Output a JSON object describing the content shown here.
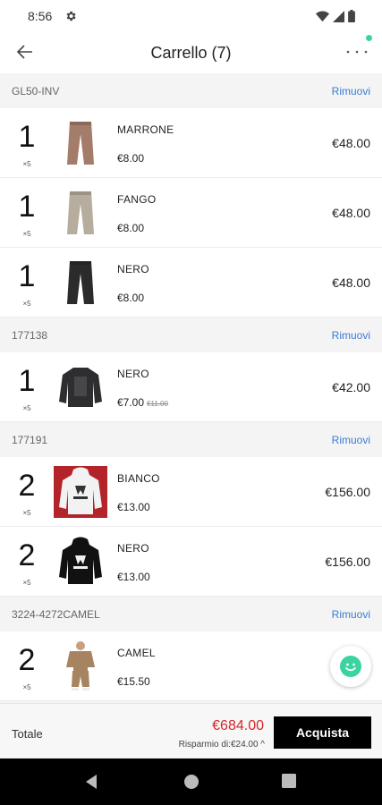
{
  "status_bar": {
    "time": "8:56"
  },
  "header": {
    "title": "Carrello (7)"
  },
  "groups": [
    {
      "code": "GL50-INV",
      "remove_label": "Rimuovi",
      "items": [
        {
          "qty": "1",
          "qty_suffix": "×5",
          "name": "MARRONE",
          "price": "€8.00",
          "total": "€48.00",
          "image": "pants-icon",
          "color": "#a47c6a"
        },
        {
          "qty": "1",
          "qty_suffix": "×5",
          "name": "FANGO",
          "price": "€8.00",
          "total": "€48.00",
          "image": "pants-icon",
          "color": "#b7ad9e"
        },
        {
          "qty": "1",
          "qty_suffix": "×5",
          "name": "NERO",
          "price": "€8.00",
          "total": "€48.00",
          "image": "pants-icon",
          "color": "#2b2b2b"
        }
      ]
    },
    {
      "code": "177138",
      "remove_label": "Rimuovi",
      "items": [
        {
          "qty": "1",
          "qty_suffix": "×5",
          "name": "NERO",
          "price": "€7.00",
          "old_price": "€11.00",
          "total": "€42.00",
          "image": "sweater-icon",
          "color": "#2e2e30"
        }
      ]
    },
    {
      "code": "177191",
      "remove_label": "Rimuovi",
      "items": [
        {
          "qty": "2",
          "qty_suffix": "×5",
          "name": "BIANCO",
          "price": "€13.00",
          "total": "€156.00",
          "image": "hoodie-icon",
          "color": "#f2f2f2"
        },
        {
          "qty": "2",
          "qty_suffix": "×5",
          "name": "NERO",
          "price": "€13.00",
          "total": "€156.00",
          "image": "hoodie-icon",
          "color": "#111111"
        }
      ]
    },
    {
      "code": "3224-4272CAMEL",
      "remove_label": "Rimuovi",
      "items": [
        {
          "qty": "2",
          "qty_suffix": "×5",
          "name": "CAMEL",
          "price": "€15.50",
          "total": "€",
          "image": "outfit-icon",
          "color": "#a68462"
        }
      ]
    }
  ],
  "footer": {
    "total_label": "Totale",
    "total_value": "€684.00",
    "saving": "Risparmio di:€24.00 ^",
    "buy_label": "Acquista"
  },
  "colors": {
    "accent_link": "#3a7bd5",
    "total_red": "#d4262c",
    "fab_green": "#3bd3a1"
  }
}
